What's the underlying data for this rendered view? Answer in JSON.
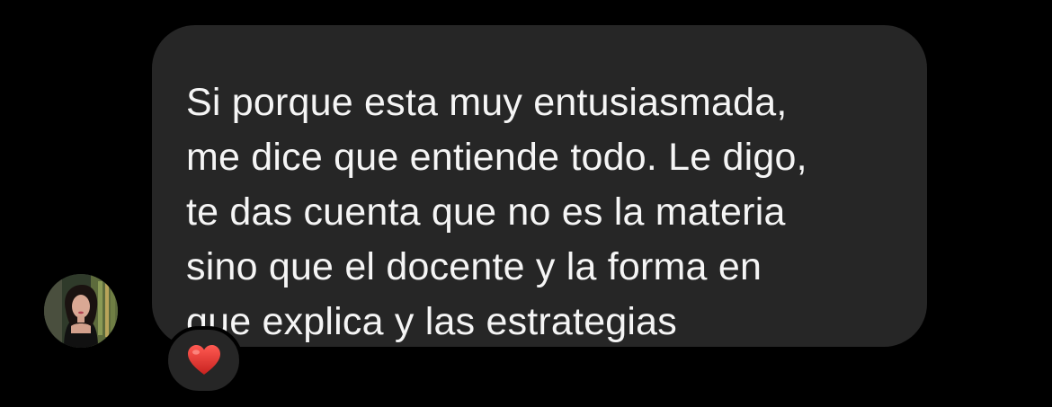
{
  "message": {
    "lines": [
      "Si porque esta muy entusiasmada,",
      "me dice que entiende todo. Le digo,",
      "te das cuenta que no es la materia",
      "sino que el docente y la forma en",
      "que explica y las estrategias"
    ]
  },
  "reaction": {
    "icon": "heart-icon",
    "color": "#e0342f"
  },
  "sender": {
    "avatar_icon": "avatar"
  },
  "colors": {
    "background": "#000000",
    "bubble": "#262626",
    "text": "#f5f5f5"
  }
}
